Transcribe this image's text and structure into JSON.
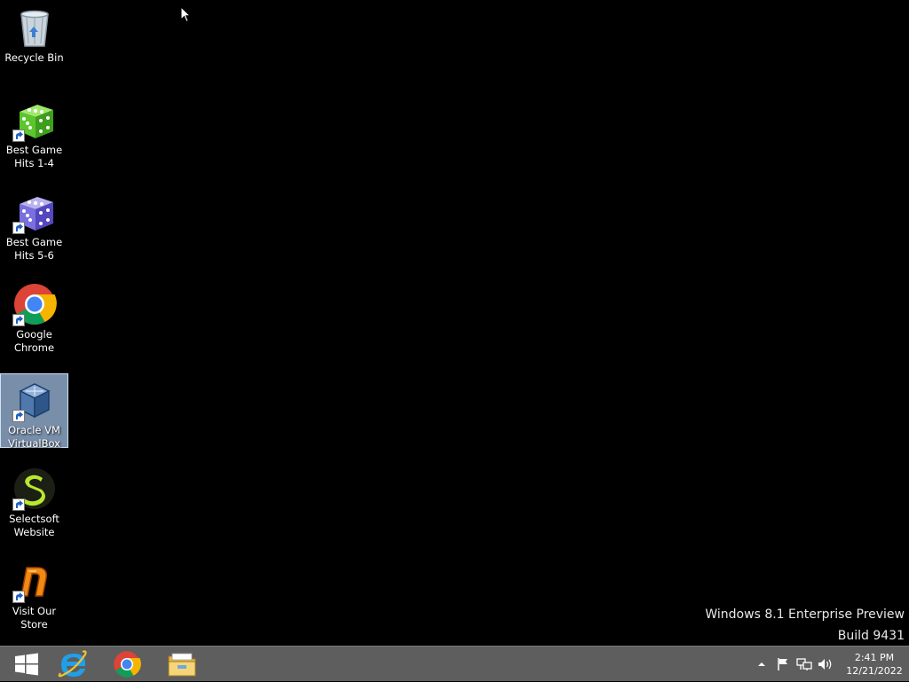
{
  "desktop": {
    "icons": [
      {
        "label": "Recycle Bin"
      },
      {
        "label": "Best Game Hits 1-4"
      },
      {
        "label": "Best Game Hits 5-6"
      },
      {
        "label": "Google Chrome"
      },
      {
        "label": "Oracle VM VirtualBox",
        "selected": true
      },
      {
        "label": "Selectsoft Website"
      },
      {
        "label": "Visit Our Store"
      }
    ],
    "watermark": {
      "line1": "Windows 8.1 Enterprise Preview",
      "line2": "Build 9431"
    }
  },
  "taskbar": {
    "pinned": [
      "start-icon",
      "internet-explorer-icon",
      "chrome-icon",
      "file-explorer-icon"
    ],
    "tray_icons": [
      "show-hidden-icons",
      "action-center-flag-icon",
      "network-icon",
      "volume-icon"
    ],
    "clock": {
      "time": "2:41 PM",
      "date": "12/21/2022"
    }
  },
  "colors": {
    "desktop_bg": "#000000",
    "taskbar_bg": "#5e5e5e",
    "selection": "#a0bee1"
  }
}
